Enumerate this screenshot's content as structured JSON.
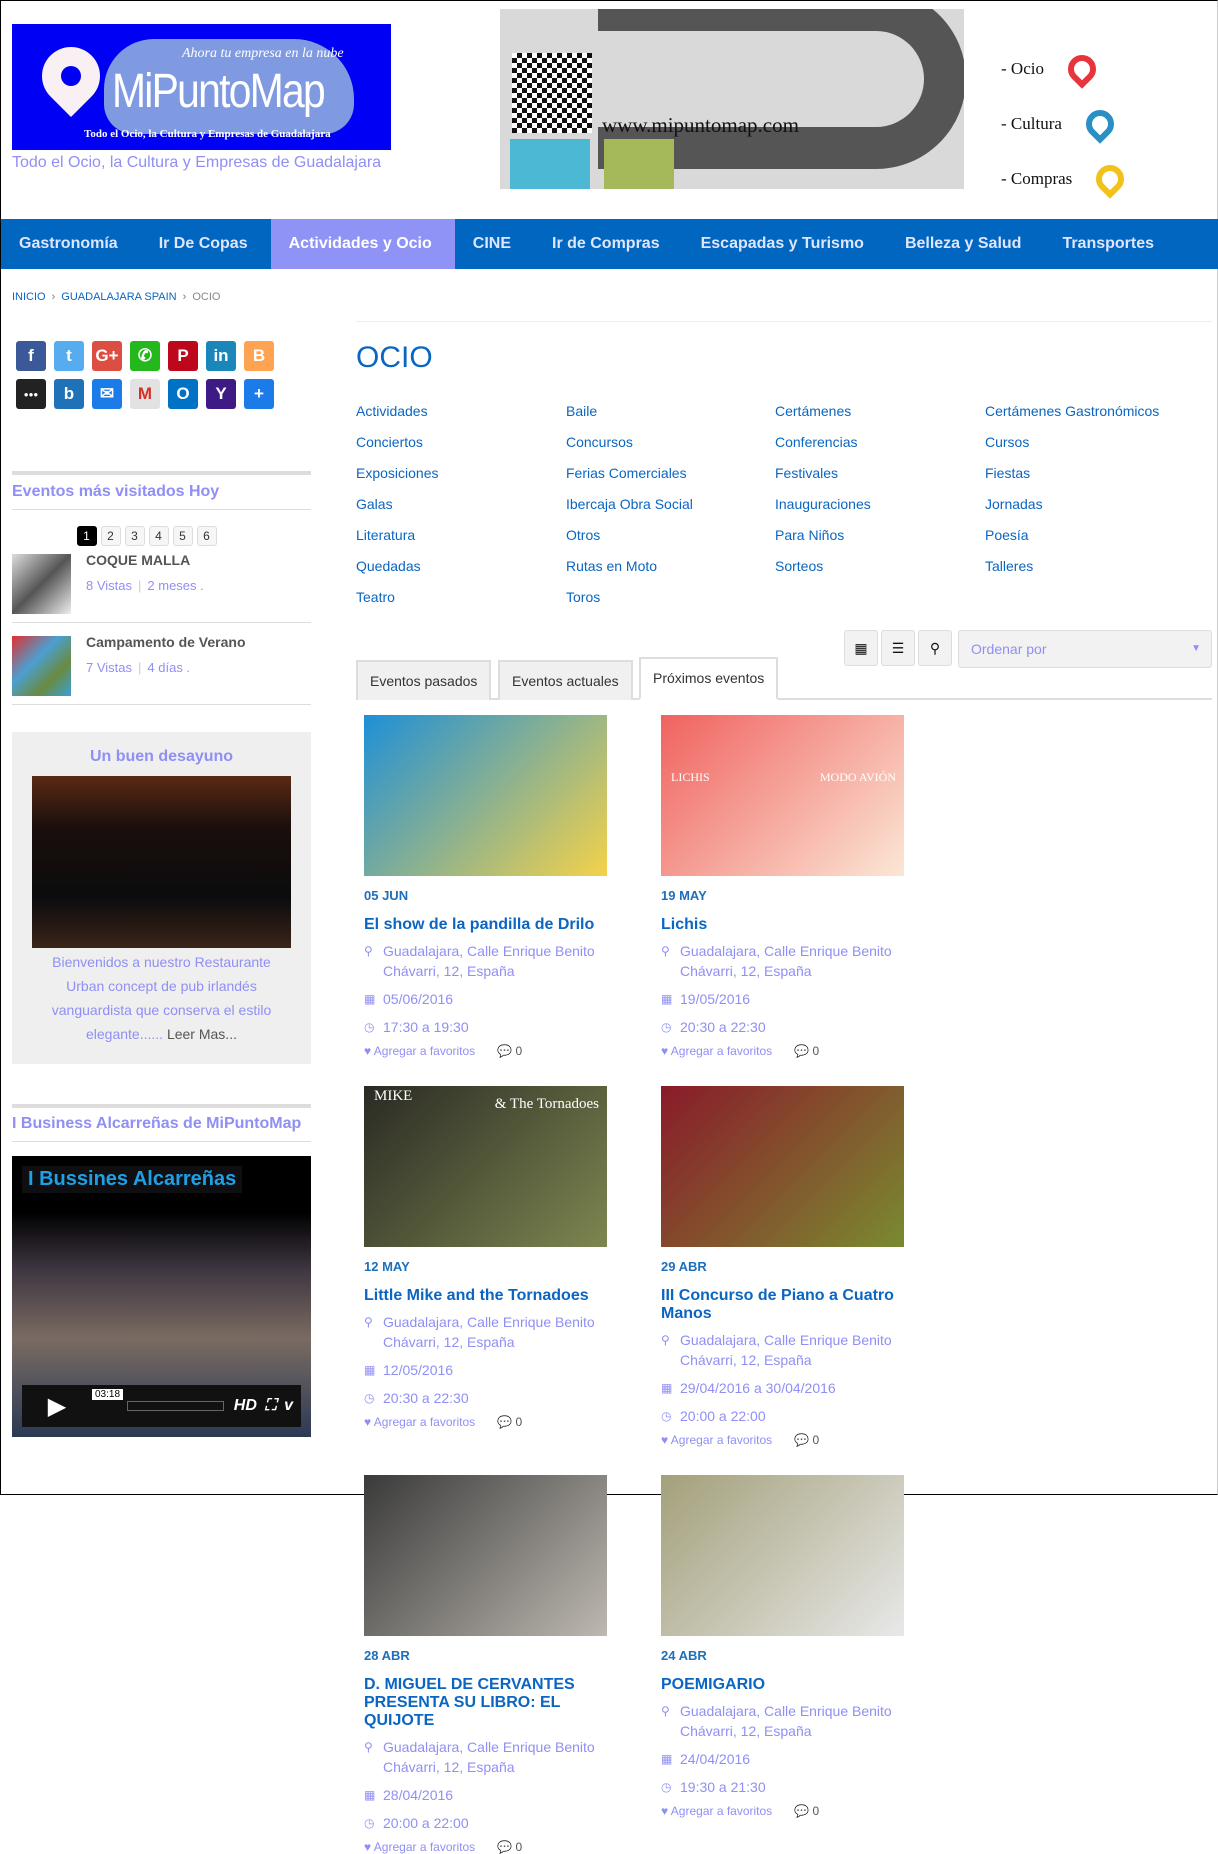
{
  "header": {
    "logo_name": "MiPuntoMap",
    "logo_slogan": "Ahora tu empresa en la nube",
    "logo_sub": "Todo el Ocio, la Cultura y Empresas de Guadalajara",
    "tagline": "Todo el Ocio, la Cultura y Empresas de Guadalajara",
    "banner": {
      "url": "www.mipuntomap.com",
      "legend": [
        {
          "label": "- Ocio",
          "color": "#e8343c"
        },
        {
          "label": "- Cultura",
          "color": "#2a8fc4"
        },
        {
          "label": "- Compras",
          "color": "#f2c21b"
        }
      ]
    }
  },
  "nav": {
    "items": [
      "Gastronomía",
      "Ir De Copas",
      "Actividades y Ocio",
      "CINE",
      "Ir de Compras",
      "Escapadas y Turismo",
      "Belleza y Salud",
      "Transportes"
    ],
    "active": "Actividades y Ocio"
  },
  "breadcrumb": {
    "items": [
      "INICIO",
      "GUADALAJARA SPAIN"
    ],
    "current": "OCIO"
  },
  "sidebar": {
    "share_icons": [
      {
        "icon": "facebook-icon",
        "glyph": "f",
        "color": "#3b5998"
      },
      {
        "icon": "twitter-icon",
        "glyph": "t",
        "color": "#55acee"
      },
      {
        "icon": "google-plus-icon",
        "glyph": "G+",
        "color": "#dc4e41"
      },
      {
        "icon": "whatsapp-icon",
        "glyph": "✆",
        "color": "#25b81d"
      },
      {
        "icon": "pinterest-icon",
        "glyph": "P",
        "color": "#bd081c"
      },
      {
        "icon": "linkedin-icon",
        "glyph": "in",
        "color": "#1b86b9"
      },
      {
        "icon": "blogger-icon",
        "glyph": "B",
        "color": "#fda352"
      },
      {
        "icon": "myspace-icon",
        "glyph": "●●●",
        "color": "#222"
      },
      {
        "icon": "bitly-icon",
        "glyph": "b",
        "color": "#1f72b8"
      },
      {
        "icon": "email-icon",
        "glyph": "✉",
        "color": "#1b7be8"
      },
      {
        "icon": "gmail-icon",
        "glyph": "M",
        "color": "#e2e2e2"
      },
      {
        "icon": "outlook-icon",
        "glyph": "O",
        "color": "#0072c6"
      },
      {
        "icon": "yahoo-icon",
        "glyph": "Y",
        "color": "#3e1a85"
      },
      {
        "icon": "more-icon",
        "glyph": "+",
        "color": "#1b7be8"
      }
    ],
    "popular": {
      "title": "Eventos más visitados Hoy",
      "pages": [
        "1",
        "2",
        "3",
        "4",
        "5",
        "6"
      ],
      "current_page": "1",
      "items": [
        {
          "title": "COQUE MALLA",
          "views": "8 Vistas",
          "ago": "2 meses ."
        },
        {
          "title": "Campamento de Verano",
          "views": "7 Vistas",
          "ago": "4 días ."
        }
      ]
    },
    "ad": {
      "title": "Un buen desayuno",
      "text": "Bienvenidos a nuestro Restaurante Urban concept de pub irlandés vanguardista que conserva el estilo elegante......",
      "more": " Leer Mas..."
    },
    "business": {
      "title": "I Business Alcarreñas de MiPuntoMap",
      "video_title": "I Bussines Alcarreñas",
      "time": "03:18",
      "hd": "HD"
    }
  },
  "main": {
    "title": "OCIO",
    "categories": [
      "Actividades",
      "Baile",
      "Certámenes",
      "Certámenes Gastronómicos",
      "Conciertos",
      "Concursos",
      "Conferencias",
      "Cursos",
      "Exposiciones",
      "Ferias Comerciales",
      "Festivales",
      "Fiestas",
      "Galas",
      "Ibercaja Obra Social",
      "Inauguraciones",
      "Jornadas",
      "Literatura",
      "Otros",
      "Para Niños",
      "Poesía",
      "Quedadas",
      "Rutas en Moto",
      "Sorteos",
      "Talleres",
      "Teatro",
      "Toros"
    ],
    "tabs": [
      "Eventos pasados",
      "Eventos actuales",
      "Próximos eventos"
    ],
    "active_tab": "Próximos eventos",
    "sort_placeholder": "Ordenar por",
    "fav_label": "Agregar a favoritos",
    "events": [
      {
        "day": "05 JUN",
        "title": "El show de la pandilla de Drilo",
        "address": "Guadalajara, Calle Enrique Benito Chávarri, 12, España",
        "date": "05/06/2016",
        "time": "17:30 a 19:30",
        "comments": "0",
        "image_colors": [
          "#1e8fd8",
          "#f4d24a"
        ]
      },
      {
        "day": "19 MAY",
        "title": "Lichis",
        "address": "Guadalajara, Calle Enrique Benito Chávarri, 12, España",
        "date": "19/05/2016",
        "time": "20:30 a 22:30",
        "comments": "0",
        "image_colors": [
          "#f0625f",
          "#fbe7d6"
        ],
        "image_text": [
          "LICHIS",
          "MODO AVIÓN"
        ]
      },
      {
        "day": "12 MAY",
        "title": "Little Mike and the Tornadoes",
        "address": "Guadalajara, Calle Enrique Benito Chávarri, 12, España",
        "date": "12/05/2016",
        "time": "20:30 a 22:30",
        "comments": "0",
        "image_colors": [
          "#2a2a24",
          "#7d8650"
        ],
        "image_text": [
          "MIKE",
          "& The Tornadoes"
        ]
      },
      {
        "day": "29 ABR",
        "title": "III Concurso de Piano a Cuatro Manos",
        "address": "Guadalajara, Calle Enrique Benito Chávarri, 12, España",
        "date": "29/04/2016 a 30/04/2016",
        "time": "20:00 a 22:00",
        "comments": "0",
        "image_colors": [
          "#8a1a2a",
          "#7a8a30"
        ]
      },
      {
        "day": "28 ABR",
        "title": "D. MIGUEL DE CERVANTES PRESENTA SU LIBRO: EL QUIJOTE",
        "address": "Guadalajara, Calle Enrique Benito Chávarri, 12, España",
        "date": "28/04/2016",
        "time": "20:00 a 22:00",
        "comments": "0",
        "image_colors": [
          "#3a3a3a",
          "#bdb8b0"
        ]
      },
      {
        "day": "24 ABR",
        "title": "POEMIGARIO",
        "address": "Guadalajara, Calle Enrique Benito Chávarri, 12, España",
        "date": "24/04/2016",
        "time": "19:30 a 21:30",
        "comments": "0",
        "image_colors": [
          "#a3a07a",
          "#e8e8e8"
        ]
      }
    ]
  }
}
